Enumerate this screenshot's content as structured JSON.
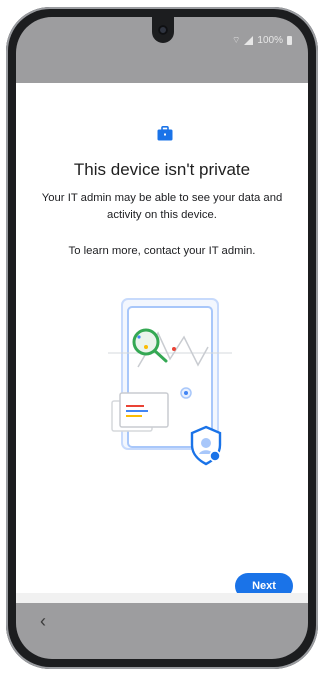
{
  "status": {
    "right_text": "100%",
    "battery_icon": "battery-icon",
    "signal_icon": "signal-icon"
  },
  "screen": {
    "header_icon": "briefcase-icon",
    "title": "This device isn't private",
    "description": "Your IT admin may be able to see your data and activity on this device.",
    "contact": "To learn more, contact your IT admin.",
    "illustration": "privacy-illustration",
    "next_label": "Next"
  },
  "nav": {
    "back_icon": "back-icon",
    "back_glyph": "‹"
  },
  "colors": {
    "accent": "#1a73e8",
    "status_bar": "#9d9d9f",
    "bezel": "#1c1d1f"
  }
}
